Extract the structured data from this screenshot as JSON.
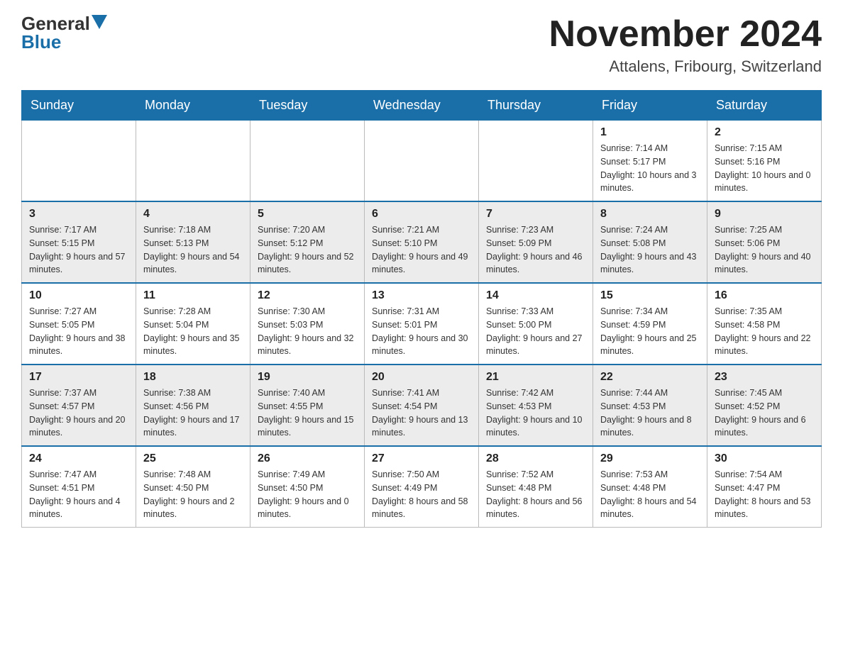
{
  "header": {
    "logo_general": "General",
    "logo_blue": "Blue",
    "title": "November 2024",
    "subtitle": "Attalens, Fribourg, Switzerland"
  },
  "days_of_week": [
    "Sunday",
    "Monday",
    "Tuesday",
    "Wednesday",
    "Thursday",
    "Friday",
    "Saturday"
  ],
  "weeks": [
    [
      {
        "day": "",
        "sunrise": "",
        "sunset": "",
        "daylight": ""
      },
      {
        "day": "",
        "sunrise": "",
        "sunset": "",
        "daylight": ""
      },
      {
        "day": "",
        "sunrise": "",
        "sunset": "",
        "daylight": ""
      },
      {
        "day": "",
        "sunrise": "",
        "sunset": "",
        "daylight": ""
      },
      {
        "day": "",
        "sunrise": "",
        "sunset": "",
        "daylight": ""
      },
      {
        "day": "1",
        "sunrise": "Sunrise: 7:14 AM",
        "sunset": "Sunset: 5:17 PM",
        "daylight": "Daylight: 10 hours and 3 minutes."
      },
      {
        "day": "2",
        "sunrise": "Sunrise: 7:15 AM",
        "sunset": "Sunset: 5:16 PM",
        "daylight": "Daylight: 10 hours and 0 minutes."
      }
    ],
    [
      {
        "day": "3",
        "sunrise": "Sunrise: 7:17 AM",
        "sunset": "Sunset: 5:15 PM",
        "daylight": "Daylight: 9 hours and 57 minutes."
      },
      {
        "day": "4",
        "sunrise": "Sunrise: 7:18 AM",
        "sunset": "Sunset: 5:13 PM",
        "daylight": "Daylight: 9 hours and 54 minutes."
      },
      {
        "day": "5",
        "sunrise": "Sunrise: 7:20 AM",
        "sunset": "Sunset: 5:12 PM",
        "daylight": "Daylight: 9 hours and 52 minutes."
      },
      {
        "day": "6",
        "sunrise": "Sunrise: 7:21 AM",
        "sunset": "Sunset: 5:10 PM",
        "daylight": "Daylight: 9 hours and 49 minutes."
      },
      {
        "day": "7",
        "sunrise": "Sunrise: 7:23 AM",
        "sunset": "Sunset: 5:09 PM",
        "daylight": "Daylight: 9 hours and 46 minutes."
      },
      {
        "day": "8",
        "sunrise": "Sunrise: 7:24 AM",
        "sunset": "Sunset: 5:08 PM",
        "daylight": "Daylight: 9 hours and 43 minutes."
      },
      {
        "day": "9",
        "sunrise": "Sunrise: 7:25 AM",
        "sunset": "Sunset: 5:06 PM",
        "daylight": "Daylight: 9 hours and 40 minutes."
      }
    ],
    [
      {
        "day": "10",
        "sunrise": "Sunrise: 7:27 AM",
        "sunset": "Sunset: 5:05 PM",
        "daylight": "Daylight: 9 hours and 38 minutes."
      },
      {
        "day": "11",
        "sunrise": "Sunrise: 7:28 AM",
        "sunset": "Sunset: 5:04 PM",
        "daylight": "Daylight: 9 hours and 35 minutes."
      },
      {
        "day": "12",
        "sunrise": "Sunrise: 7:30 AM",
        "sunset": "Sunset: 5:03 PM",
        "daylight": "Daylight: 9 hours and 32 minutes."
      },
      {
        "day": "13",
        "sunrise": "Sunrise: 7:31 AM",
        "sunset": "Sunset: 5:01 PM",
        "daylight": "Daylight: 9 hours and 30 minutes."
      },
      {
        "day": "14",
        "sunrise": "Sunrise: 7:33 AM",
        "sunset": "Sunset: 5:00 PM",
        "daylight": "Daylight: 9 hours and 27 minutes."
      },
      {
        "day": "15",
        "sunrise": "Sunrise: 7:34 AM",
        "sunset": "Sunset: 4:59 PM",
        "daylight": "Daylight: 9 hours and 25 minutes."
      },
      {
        "day": "16",
        "sunrise": "Sunrise: 7:35 AM",
        "sunset": "Sunset: 4:58 PM",
        "daylight": "Daylight: 9 hours and 22 minutes."
      }
    ],
    [
      {
        "day": "17",
        "sunrise": "Sunrise: 7:37 AM",
        "sunset": "Sunset: 4:57 PM",
        "daylight": "Daylight: 9 hours and 20 minutes."
      },
      {
        "day": "18",
        "sunrise": "Sunrise: 7:38 AM",
        "sunset": "Sunset: 4:56 PM",
        "daylight": "Daylight: 9 hours and 17 minutes."
      },
      {
        "day": "19",
        "sunrise": "Sunrise: 7:40 AM",
        "sunset": "Sunset: 4:55 PM",
        "daylight": "Daylight: 9 hours and 15 minutes."
      },
      {
        "day": "20",
        "sunrise": "Sunrise: 7:41 AM",
        "sunset": "Sunset: 4:54 PM",
        "daylight": "Daylight: 9 hours and 13 minutes."
      },
      {
        "day": "21",
        "sunrise": "Sunrise: 7:42 AM",
        "sunset": "Sunset: 4:53 PM",
        "daylight": "Daylight: 9 hours and 10 minutes."
      },
      {
        "day": "22",
        "sunrise": "Sunrise: 7:44 AM",
        "sunset": "Sunset: 4:53 PM",
        "daylight": "Daylight: 9 hours and 8 minutes."
      },
      {
        "day": "23",
        "sunrise": "Sunrise: 7:45 AM",
        "sunset": "Sunset: 4:52 PM",
        "daylight": "Daylight: 9 hours and 6 minutes."
      }
    ],
    [
      {
        "day": "24",
        "sunrise": "Sunrise: 7:47 AM",
        "sunset": "Sunset: 4:51 PM",
        "daylight": "Daylight: 9 hours and 4 minutes."
      },
      {
        "day": "25",
        "sunrise": "Sunrise: 7:48 AM",
        "sunset": "Sunset: 4:50 PM",
        "daylight": "Daylight: 9 hours and 2 minutes."
      },
      {
        "day": "26",
        "sunrise": "Sunrise: 7:49 AM",
        "sunset": "Sunset: 4:50 PM",
        "daylight": "Daylight: 9 hours and 0 minutes."
      },
      {
        "day": "27",
        "sunrise": "Sunrise: 7:50 AM",
        "sunset": "Sunset: 4:49 PM",
        "daylight": "Daylight: 8 hours and 58 minutes."
      },
      {
        "day": "28",
        "sunrise": "Sunrise: 7:52 AM",
        "sunset": "Sunset: 4:48 PM",
        "daylight": "Daylight: 8 hours and 56 minutes."
      },
      {
        "day": "29",
        "sunrise": "Sunrise: 7:53 AM",
        "sunset": "Sunset: 4:48 PM",
        "daylight": "Daylight: 8 hours and 54 minutes."
      },
      {
        "day": "30",
        "sunrise": "Sunrise: 7:54 AM",
        "sunset": "Sunset: 4:47 PM",
        "daylight": "Daylight: 8 hours and 53 minutes."
      }
    ]
  ]
}
